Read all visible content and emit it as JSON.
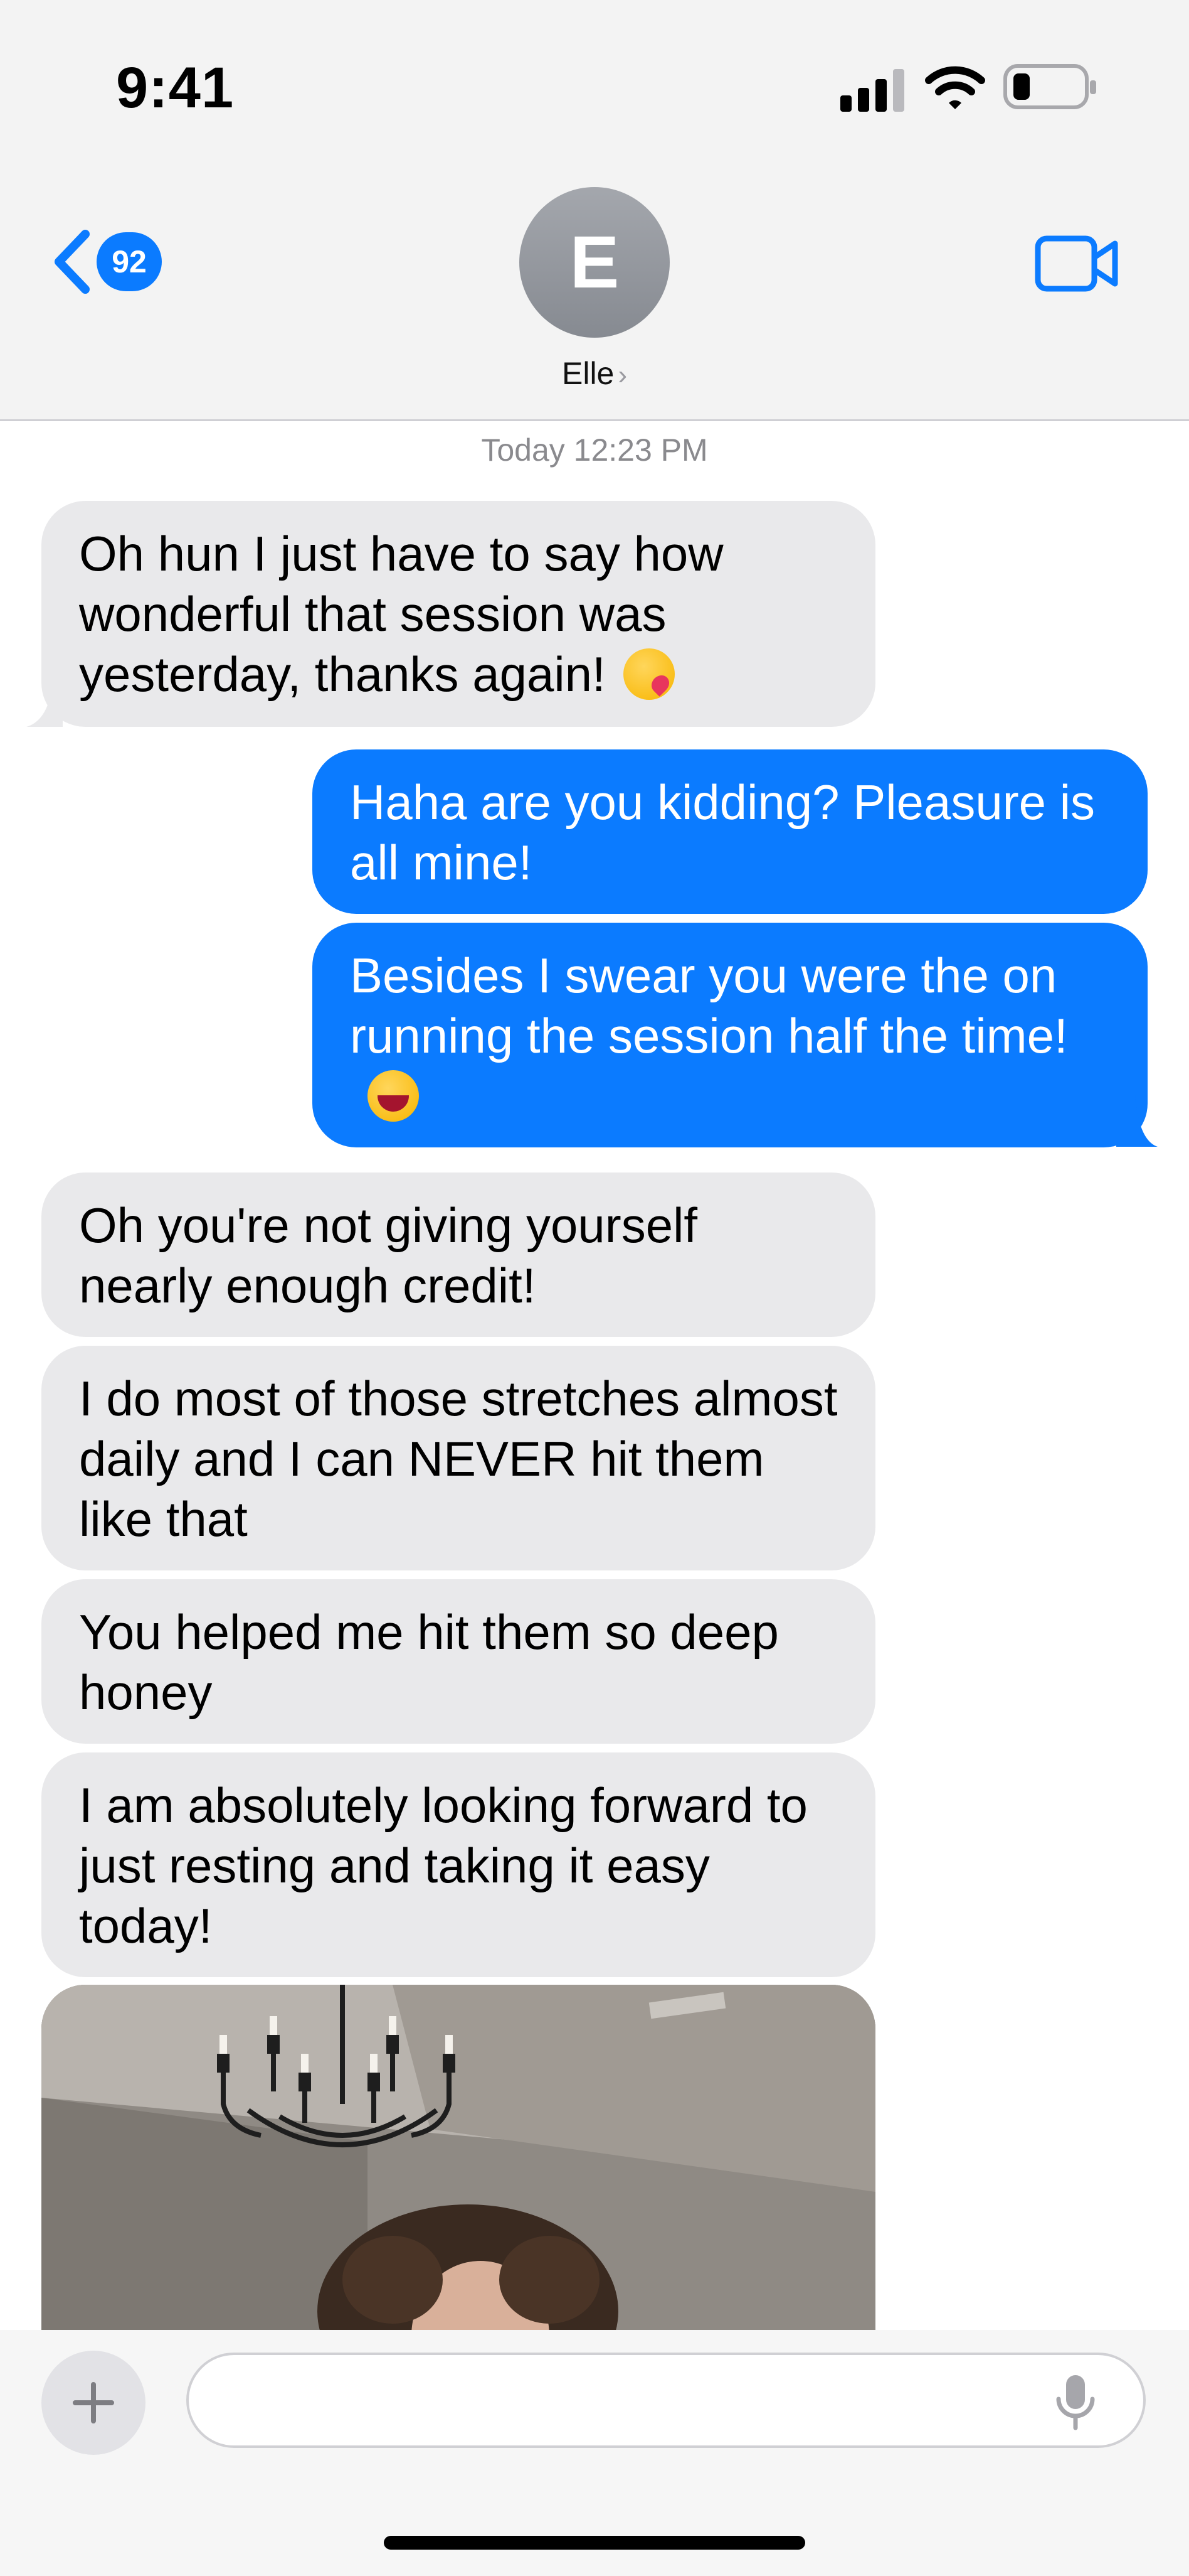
{
  "status_bar": {
    "time": "9:41"
  },
  "header": {
    "back_badge_count": "92",
    "avatar_initial": "E",
    "contact_name": "Elle",
    "chevron": "›"
  },
  "conversation": {
    "timestamp": "Today 12:23 PM",
    "messages": [
      {
        "direction": "incoming",
        "text": "Oh hun I just have to say how wonderful that session was yesterday, thanks again!",
        "emoji": "kissing-face-with-heart"
      },
      {
        "direction": "outgoing",
        "text": "Haha are you kidding? Pleasure is all mine!"
      },
      {
        "direction": "outgoing",
        "text": "Besides I swear you were the on running the session half the time!",
        "emoji": "grinning-face-with-sweat"
      },
      {
        "direction": "incoming",
        "text": "Oh you're not giving yourself nearly enough credit!"
      },
      {
        "direction": "incoming",
        "text": "I do most of those stretches almost daily and I can NEVER hit them like that"
      },
      {
        "direction": "incoming",
        "text": "You helped me hit them so deep honey"
      },
      {
        "direction": "incoming",
        "text": "I am absolutely looking forward to just resting and taking it easy today!"
      },
      {
        "direction": "incoming",
        "type": "image",
        "description": "photo attachment"
      }
    ]
  },
  "composer": {
    "placeholder": "",
    "plus_icon": "plus-icon",
    "mic_icon": "microphone-icon"
  },
  "colors": {
    "accent_blue": "#0b7bff",
    "incoming_bubble": "#e9e9eb",
    "header_bg": "#f3f3f3"
  }
}
